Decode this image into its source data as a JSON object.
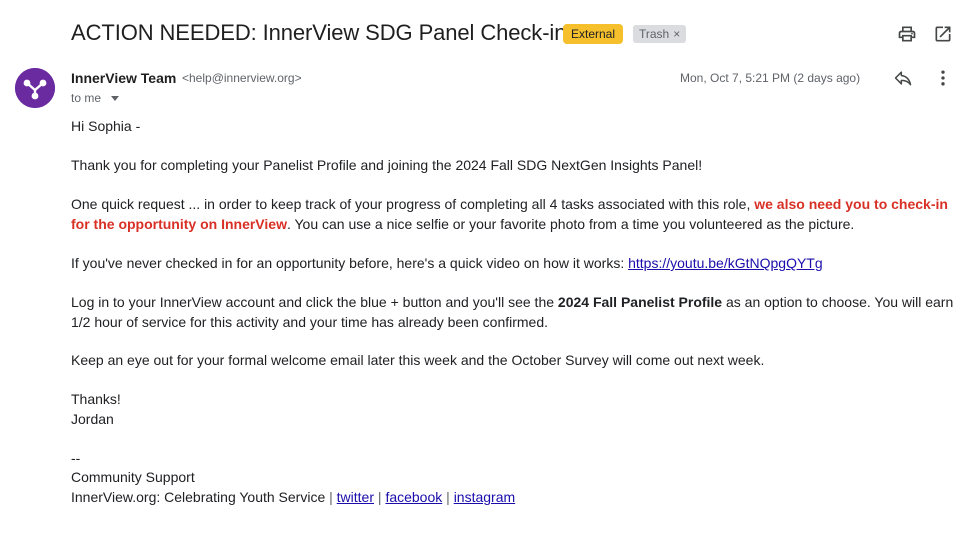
{
  "header": {
    "subject": "ACTION NEEDED: InnerView SDG Panel Check-in",
    "label_external": "External",
    "label_trash": "Trash",
    "label_trash_close": "×"
  },
  "message": {
    "sender_name": "InnerView Team",
    "sender_email": "<help@innerview.org>",
    "to": "to me",
    "date": "Mon, Oct 7, 5:21 PM (2 days ago)",
    "greeting": "Hi Sophia -",
    "p1": "Thank you for completing your Panelist Profile and joining the 2024 Fall SDG NextGen Insights Panel!",
    "p2_a": "One quick request ... in order to keep track of your progress of completing all 4 tasks associated with this role, ",
    "p2_red": "we also need you to check-in for the opportunity on InnerView",
    "p2_b": ". You can use a nice selfie or your favorite photo from a time you volunteered as the picture.",
    "p3_a": "If you've never checked in for an opportunity before, here's a quick video on how it works: ",
    "p3_link": "https://youtu.be/kGtNQpgQYTg",
    "p4_a": "Log in to your InnerView account and click the blue + button and you'll see the ",
    "p4_bold": "2024 Fall Panelist Profile",
    "p4_b": " as an option to choose. You will earn 1/2 hour of service for this activity and your time has already been confirmed.",
    "p5": "Keep an eye out for your formal welcome email later this week and the October Survey will come out next week.",
    "thanks": "Thanks!",
    "signoff_name": "Jordan",
    "sig_dash": "--",
    "sig_title": "Community Support",
    "sig_org": "InnerView.org: Celebrating Youth Service",
    "sig_sep": "|",
    "sig_twitter": "twitter",
    "sig_facebook": "facebook",
    "sig_instagram": "instagram"
  },
  "icons": {
    "print": "print-icon",
    "open_new_window": "open-in-new-window-icon",
    "reply": "reply-icon",
    "more": "more-vert-icon",
    "avatar": "innerview-logo-avatar"
  },
  "colors": {
    "external_badge": "#f5c02b",
    "trash_badge": "#dadce0",
    "avatar_bg": "#6a2aa0",
    "highlight_red": "#d93025",
    "link": "#1a0dab"
  }
}
